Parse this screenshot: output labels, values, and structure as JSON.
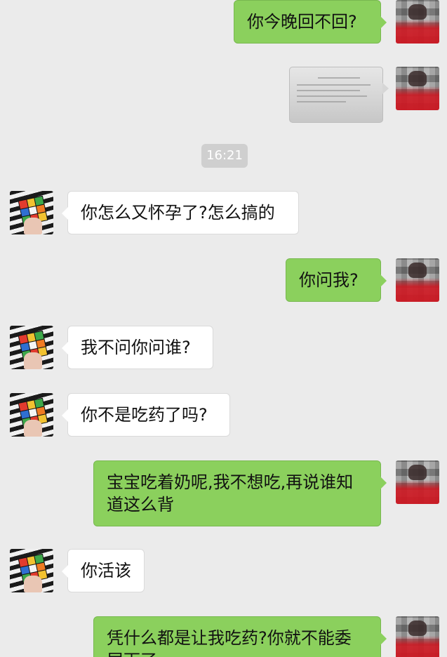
{
  "messages": [
    {
      "side": "right",
      "type": "text",
      "text": "你今晚回不回?"
    },
    {
      "side": "right",
      "type": "image",
      "description": "document-photo"
    },
    {
      "side": "center",
      "type": "time",
      "text": "16:21"
    },
    {
      "side": "left",
      "type": "text",
      "text": "你怎么又怀孕了?怎么搞的"
    },
    {
      "side": "right",
      "type": "text",
      "text": "你问我?"
    },
    {
      "side": "left",
      "type": "text",
      "text": "我不问你问谁?"
    },
    {
      "side": "left",
      "type": "text",
      "text": "你不是吃药了吗?"
    },
    {
      "side": "right",
      "type": "text",
      "text": "宝宝吃着奶呢,我不想吃,再说谁知道这么背"
    },
    {
      "side": "left",
      "type": "text",
      "text": "你活该"
    },
    {
      "side": "right",
      "type": "text",
      "text": "凭什么都是让我吃药?你就不能委屈下了"
    }
  ],
  "colors": {
    "background": "#ebebeb",
    "bubble_right": "#8bd05d",
    "bubble_left": "#ffffff",
    "time_pill": "#cfcfcf"
  },
  "icons": {
    "left_avatar": "rubiks-cube-avatar",
    "right_avatar": "pixelated-person-avatar"
  }
}
